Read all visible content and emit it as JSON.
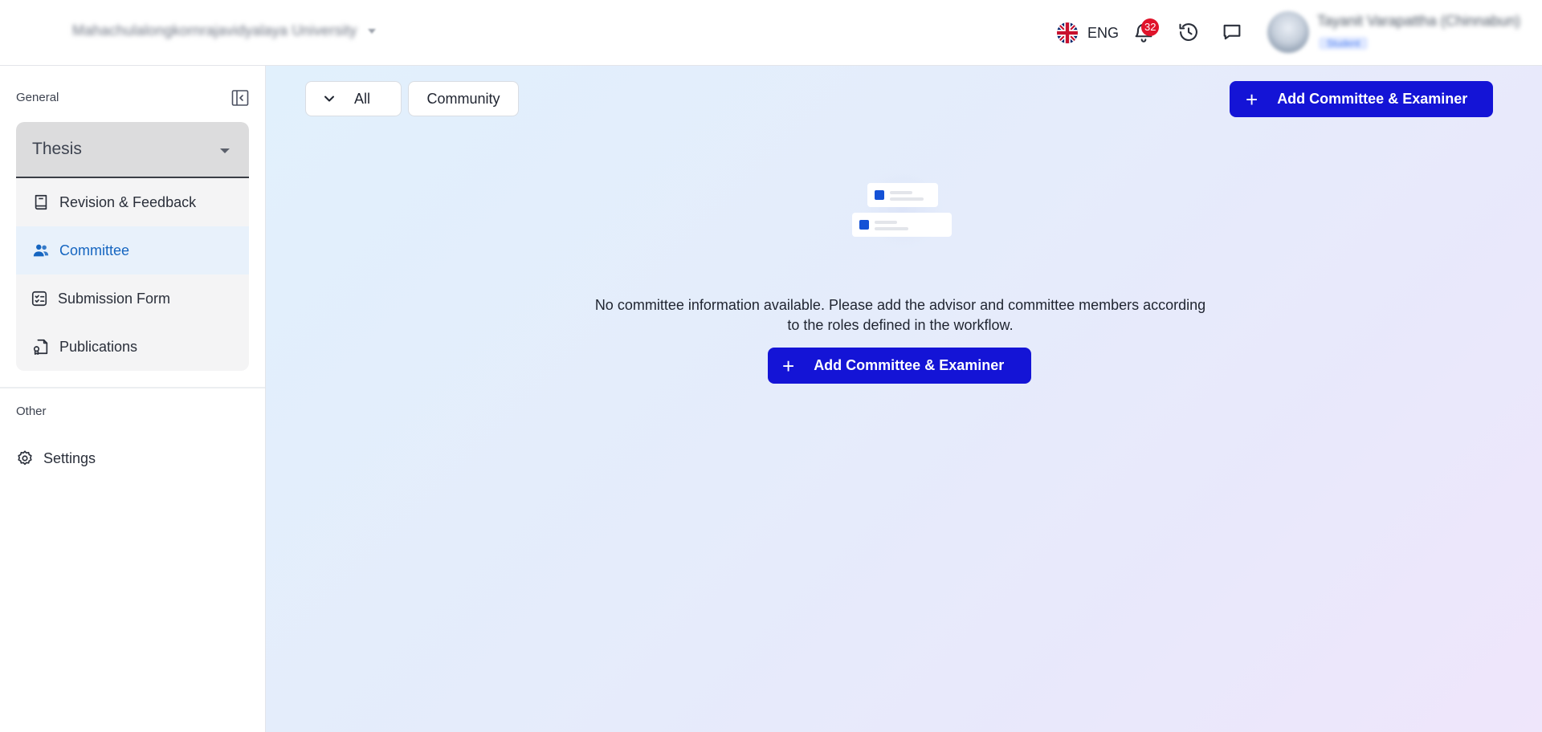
{
  "header": {
    "org_name": "Mahachulalongkornrajavidyalaya University",
    "language": "ENG",
    "notification_count": "32",
    "user_name": "Tayanit Varapattha (Chinnabun)",
    "user_role": "Student",
    "icons": [
      "uk-flag-icon",
      "bell-icon",
      "history-icon",
      "chat-icon"
    ]
  },
  "sidebar": {
    "general_label": "General",
    "thesis_select": "Thesis",
    "items": [
      {
        "label": "Revision & Feedback",
        "icon": "book-icon"
      },
      {
        "label": "Committee",
        "icon": "users-icon",
        "active": true
      },
      {
        "label": "Submission Form",
        "icon": "checklist-icon"
      },
      {
        "label": "Publications",
        "icon": "publication-icon"
      }
    ],
    "other_label": "Other",
    "settings_label": "Settings"
  },
  "main": {
    "filters": {
      "all_label": "All",
      "community_label": "Community"
    },
    "add_button_label": "Add Committee & Examiner",
    "empty_message": "No committee information available. Please add the advisor and committee members according to the roles defined in the workflow.",
    "empty_button_label": "Add Committee & Examiner"
  },
  "colors": {
    "primary": "#1414d6",
    "active_nav_bg": "#e8f1fb",
    "active_nav_text": "#1565c0",
    "badge": "#e0142b"
  }
}
